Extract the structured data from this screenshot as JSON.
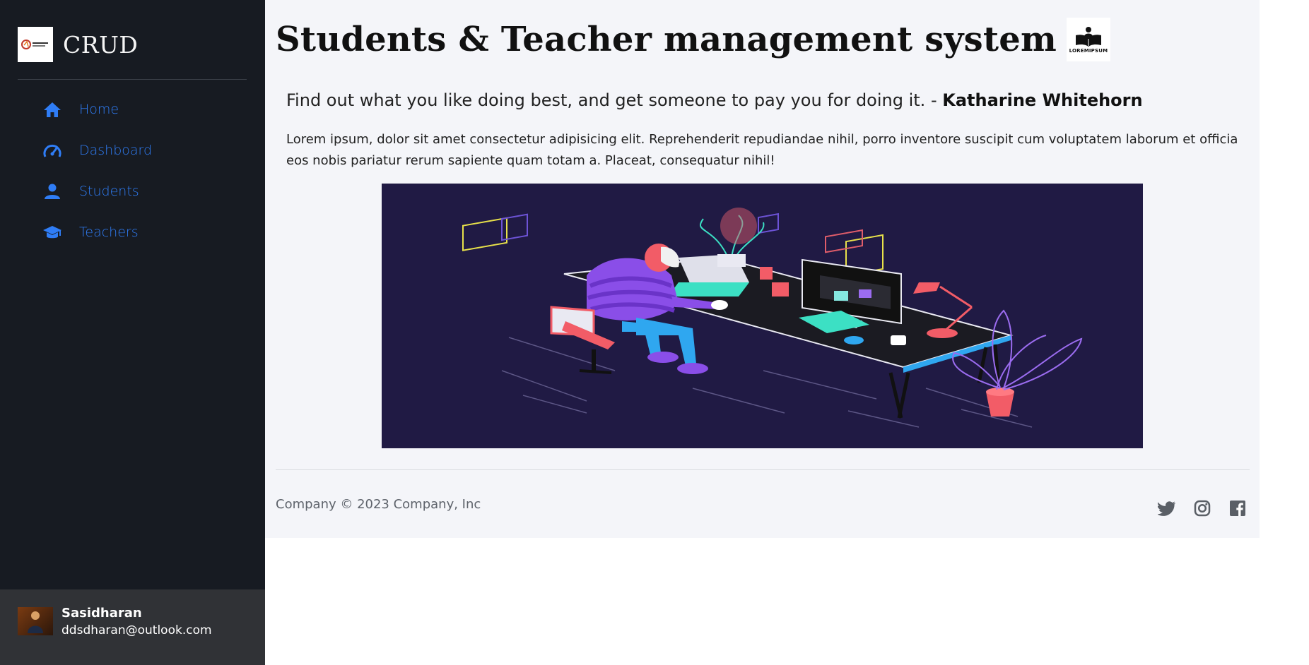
{
  "brand": {
    "title": "CRUD",
    "logo_icon": "education-logo-icon"
  },
  "sidebar": {
    "items": [
      {
        "label": "Home",
        "icon": "home-icon"
      },
      {
        "label": "Dashboard",
        "icon": "speedometer-icon"
      },
      {
        "label": "Students",
        "icon": "person-icon"
      },
      {
        "label": "Teachers",
        "icon": "graduation-cap-icon"
      }
    ],
    "accent_color": "#2f7df6",
    "background": "#171b22"
  },
  "user": {
    "name": "Sasidharan",
    "email": "ddsdharan@outlook.com"
  },
  "header": {
    "title": "Students & Teacher management system",
    "logo_text": "LOREMIPSUM"
  },
  "quote": {
    "text": "Find out what you like doing best, and get someone to pay you for doing it. - ",
    "author": "Katharine Whitehorn"
  },
  "body": {
    "paragraph": "Lorem ipsum, dolor sit amet consectetur adipisicing elit. Reprehenderit repudiandae nihil, porro inventore suscipit cum voluptatem laborum et officia eos nobis pariatur rerum sapiente quam totam a. Placeat, consequatur nihil!"
  },
  "footer": {
    "copyright": "Company  © 2023 Company, Inc",
    "socials": [
      "twitter-icon",
      "instagram-icon",
      "facebook-icon"
    ]
  }
}
